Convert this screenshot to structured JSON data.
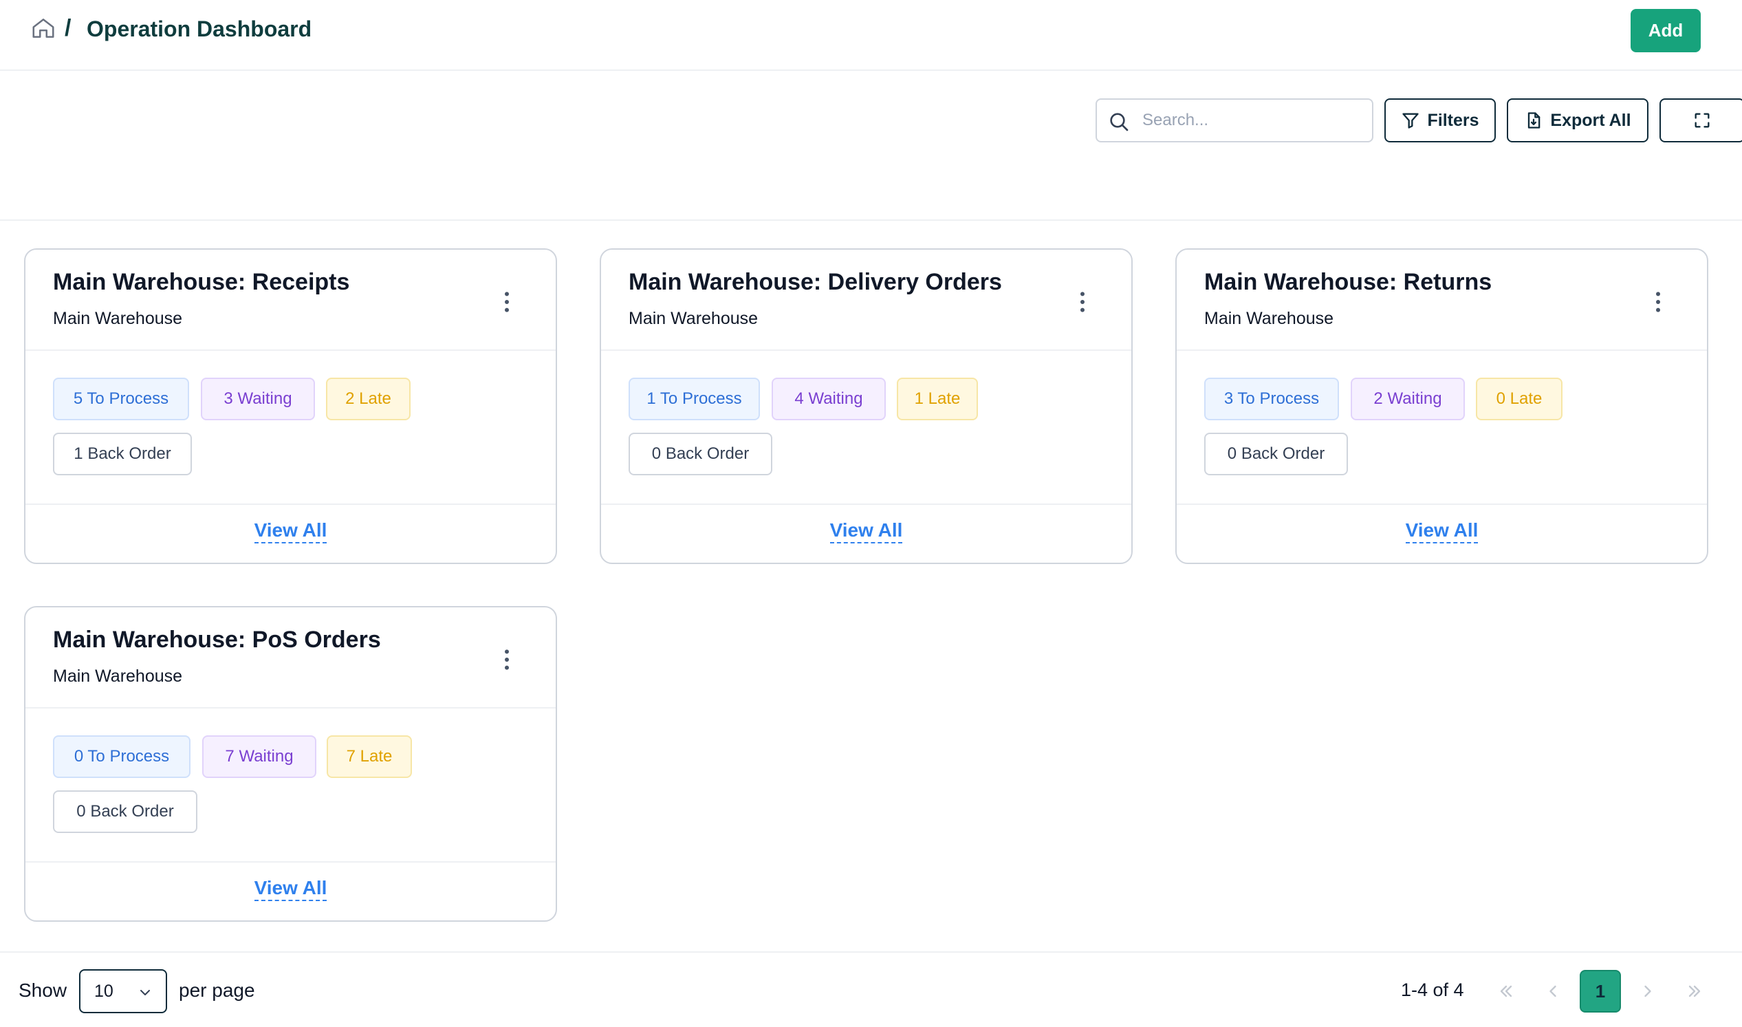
{
  "header": {
    "breadcrumb_separator": "/",
    "title": "Operation Dashboard",
    "add_label": "Add"
  },
  "toolbar": {
    "search_placeholder": "Search...",
    "filters_label": "Filters",
    "export_label": "Export All"
  },
  "cards": [
    {
      "title": "Main Warehouse: Receipts",
      "subtitle": "Main Warehouse",
      "to_process": "5 To Process",
      "waiting": "3 Waiting",
      "late": "2 Late",
      "back_order": "1 Back Order",
      "view_all": "View All"
    },
    {
      "title": "Main Warehouse: Delivery Orders",
      "subtitle": "Main Warehouse",
      "to_process": "1 To Process",
      "waiting": "4 Waiting",
      "late": "1 Late",
      "back_order": "0 Back Order",
      "view_all": "View All"
    },
    {
      "title": "Main Warehouse: Returns",
      "subtitle": "Main Warehouse",
      "to_process": "3 To Process",
      "waiting": "2 Waiting",
      "late": "0 Late",
      "back_order": "0 Back Order",
      "view_all": "View All"
    },
    {
      "title": "Main Warehouse: PoS Orders",
      "subtitle": "Main Warehouse",
      "to_process": "0 To Process",
      "waiting": "7 Waiting",
      "late": "7 Late",
      "back_order": "0 Back Order",
      "view_all": "View All"
    }
  ],
  "pagination": {
    "show_label": "Show",
    "page_size": "10",
    "per_page_label": "per page",
    "range": "1-4 of 4",
    "current_page": "1"
  },
  "colors": {
    "primary": "#17a37c",
    "link": "#2f80ed",
    "to_process": "#2e6fd6",
    "waiting": "#7a3fd1",
    "late": "#e0a100"
  }
}
